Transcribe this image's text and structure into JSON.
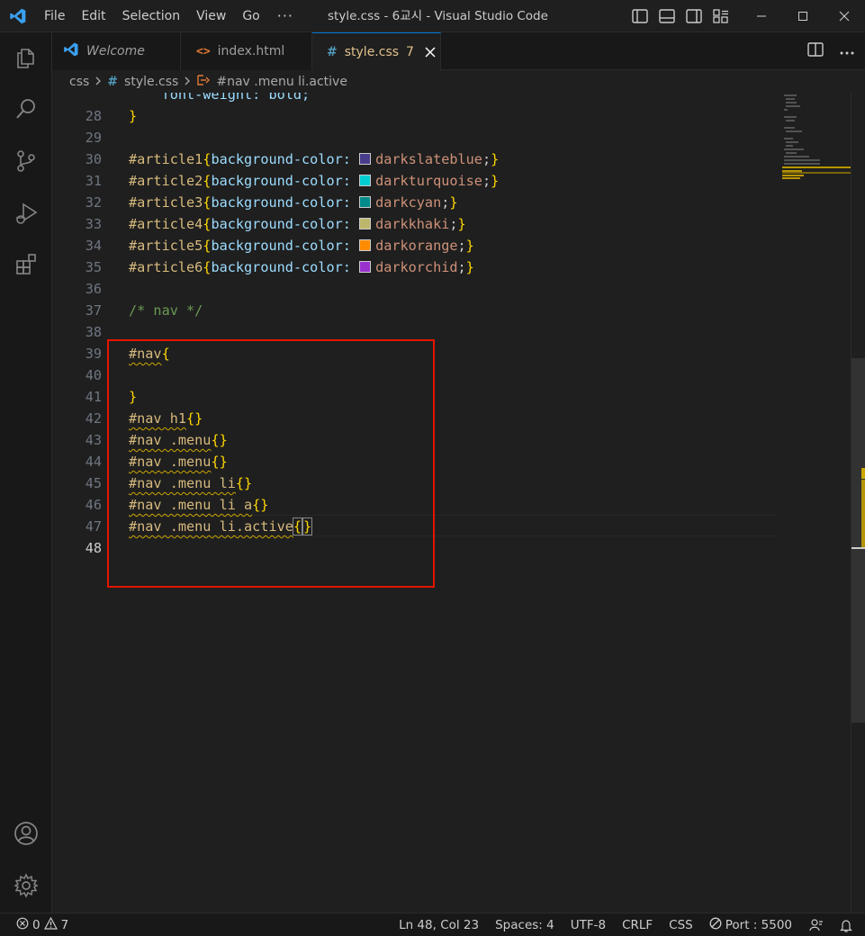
{
  "window": {
    "title": "style.css - 6교시 - Visual Studio Code",
    "menu": [
      "File",
      "Edit",
      "Selection",
      "View",
      "Go"
    ],
    "menu_more": "···"
  },
  "tabs": [
    {
      "label": "Welcome",
      "icon": "vscode-icon",
      "active": false
    },
    {
      "label": "index.html",
      "icon": "html-icon",
      "active": false
    },
    {
      "label": "style.css",
      "icon": "css-hash-icon",
      "active": true,
      "problems": "7"
    }
  ],
  "tab_icons": {
    "html": "<>",
    "css": "#"
  },
  "breadcrumb": {
    "folder": "css",
    "file_icon": "#",
    "file": "style.css",
    "symbol": "#nav .menu li.active"
  },
  "code": {
    "line28": {
      "num": "28",
      "text": "    font-weight: bold;"
    },
    "line29": {
      "num": "29",
      "text": "}"
    },
    "line30": {
      "num": "30"
    },
    "line31": {
      "num": "31",
      "sel": "#article1",
      "prop": "background-color:",
      "val": "darkslateblue",
      "color": "#483d8b"
    },
    "line32": {
      "num": "32",
      "sel": "#article2",
      "prop": "background-color:",
      "val": "darkturquoise",
      "color": "#00ced1"
    },
    "line33": {
      "num": "33",
      "sel": "#article3",
      "prop": "background-color:",
      "val": "darkcyan",
      "color": "#008b8b"
    },
    "line34": {
      "num": "34",
      "sel": "#article4",
      "prop": "background-color:",
      "val": "darkkhaki",
      "color": "#bdb76b"
    },
    "line35": {
      "num": "35",
      "sel": "#article5",
      "prop": "background-color:",
      "val": "darkorange",
      "color": "#ff8c00"
    },
    "line36": {
      "num": "36",
      "sel": "#article6",
      "prop": "background-color:",
      "val": "darkorchid",
      "color": "#9932cc"
    },
    "line37": {
      "num": "37"
    },
    "line38": {
      "num": "38",
      "comment": "/* nav */"
    },
    "line39": {
      "num": "39"
    },
    "line40": {
      "num": "40",
      "sel": "#nav"
    },
    "line41": {
      "num": "41"
    },
    "line42": {
      "num": "42",
      "text": "}"
    },
    "line43": {
      "num": "43",
      "sel": "#nav h1"
    },
    "line44": {
      "num": "44",
      "sel": "#nav .menu"
    },
    "line45": {
      "num": "45",
      "sel": "#nav .menu"
    },
    "line46": {
      "num": "46",
      "sel": "#nav .menu li"
    },
    "line47": {
      "num": "47",
      "sel": "#nav .menu li a"
    },
    "line48": {
      "num": "48",
      "sel": "#nav .menu li.active"
    }
  },
  "punct": {
    "open": "{",
    "close": "}",
    "pair": "{}",
    "semi": ";",
    "space": " "
  },
  "status": {
    "errors": "0",
    "warnings": "7",
    "position": "Ln 48, Col 23",
    "spaces": "Spaces: 4",
    "encoding": "UTF-8",
    "eol": "CRLF",
    "language": "CSS",
    "port": "Port : 5500"
  },
  "colors": {
    "accent": "#0078d4",
    "highlight_box": "#e51400",
    "warning": "#cca700"
  }
}
